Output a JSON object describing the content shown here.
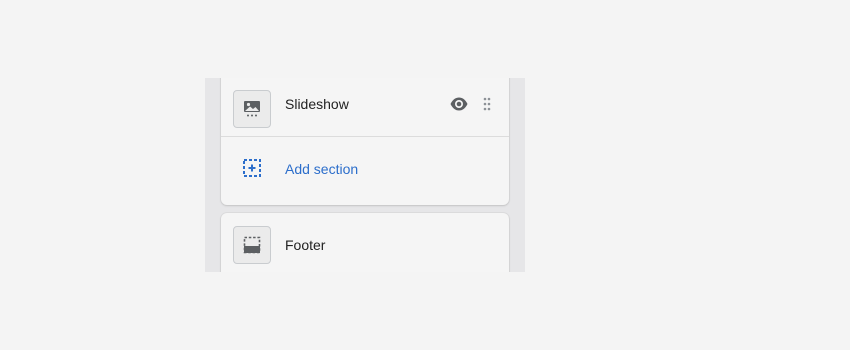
{
  "sections": {
    "slideshow": {
      "label": "Slideshow",
      "icon": "image-icon"
    },
    "add_section": {
      "label": "Add section",
      "icon": "add-section-icon",
      "color": "#2c6ecb"
    },
    "footer": {
      "label": "Footer",
      "icon": "footer-icon"
    }
  },
  "actions": {
    "visibility_icon": "eye-icon",
    "drag_icon": "drag-handle-icon"
  }
}
